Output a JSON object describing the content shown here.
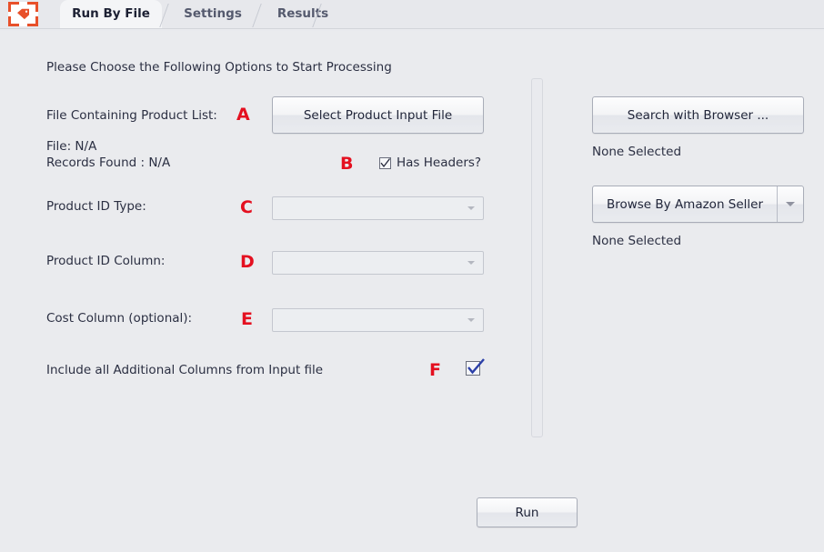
{
  "window": {
    "title": "Run By File",
    "background_color": "#eaebee",
    "accent_color": "#e8502a",
    "marker_color": "#e41020"
  },
  "logo": {
    "icon": "price-tag-icon"
  },
  "tabs": [
    {
      "label": "Run By File",
      "active": true
    },
    {
      "label": "Settings",
      "active": false
    },
    {
      "label": "Results",
      "active": false
    }
  ],
  "main": {
    "intro": "Please Choose the Following Options to Start Processing",
    "labels": {
      "file_containing": "File Containing Product List:",
      "file_status": "File: N/A",
      "records_found": "Records Found : N/A",
      "product_id_type": "Product ID Type:",
      "product_id_column": "Product ID Column:",
      "cost_column": "Cost Column (optional):",
      "include_additional": "Include all Additional Columns from Input file"
    },
    "markers": {
      "a": "A",
      "b": "B",
      "c": "C",
      "d": "D",
      "e": "E",
      "f": "F"
    },
    "buttons": {
      "select_input_file": "Select Product Input File",
      "run": "Run"
    },
    "checkboxes": {
      "has_headers_label": "Has Headers?",
      "has_headers_checked": true,
      "include_additional_checked": true
    },
    "combos": {
      "product_id_type_value": "",
      "product_id_column_value": "",
      "cost_column_value": ""
    }
  },
  "right_panel": {
    "search_with_browser_label": "Search with Browser ...",
    "search_with_browser_status": "None Selected",
    "browse_amazon_seller_label": "Browse By Amazon Seller",
    "browse_amazon_seller_status": "None Selected",
    "dropdown_icon": "chevron-down-icon"
  }
}
